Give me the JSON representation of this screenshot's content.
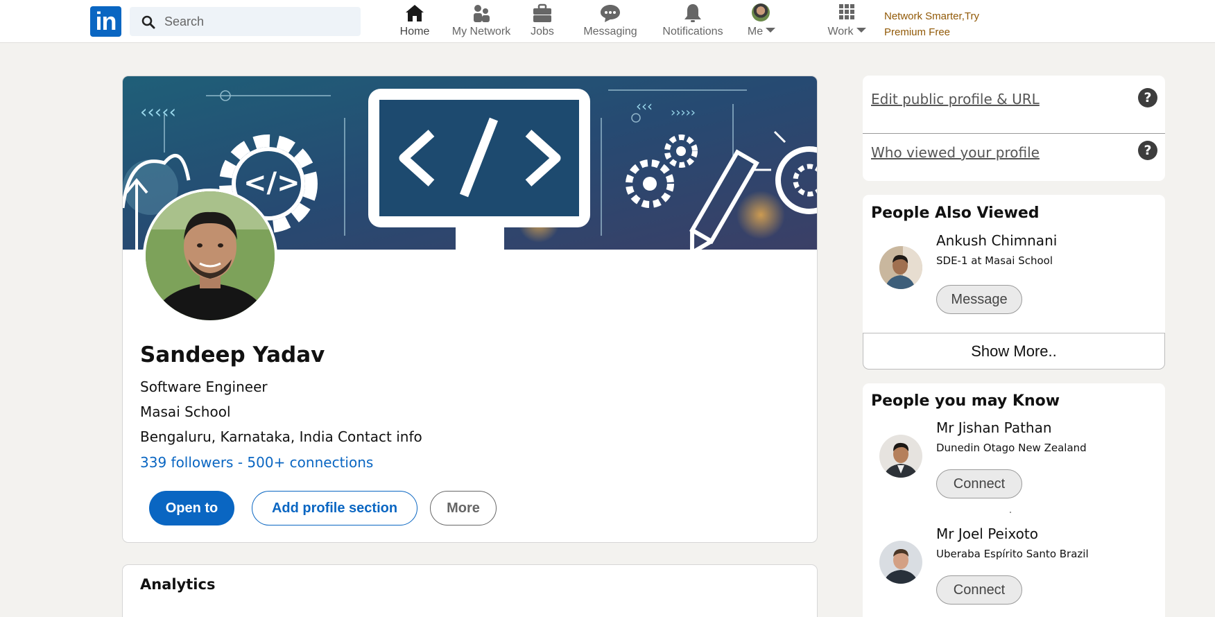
{
  "nav": {
    "search_placeholder": "Search",
    "items": [
      {
        "label": "Home",
        "icon": "home-icon"
      },
      {
        "label": "My Network",
        "icon": "network-icon"
      },
      {
        "label": "Jobs",
        "icon": "briefcase-icon"
      },
      {
        "label": "Messaging",
        "icon": "chat-icon"
      },
      {
        "label": "Notifications",
        "icon": "bell-icon"
      },
      {
        "label": "Me",
        "icon": "avatar"
      },
      {
        "label": "Work",
        "icon": "grid-icon"
      }
    ],
    "premium_line1": "Network Smarter,Try",
    "premium_line2": "Premium Free",
    "logo_text": "in"
  },
  "profile": {
    "name": "Sandeep Yadav",
    "headline": "Software Engineer",
    "company": "Masai School",
    "location": "Bengaluru, Karnataka, India Contact info",
    "stats": "339 followers - 500+ connections",
    "buttons": {
      "open_to": "Open to",
      "add_section": "Add profile section",
      "more": "More"
    }
  },
  "analytics": {
    "title": "Analytics"
  },
  "sidebar": {
    "links": [
      {
        "label": "Edit public profile & URL",
        "help": "?"
      },
      {
        "label": "Who viewed your profile",
        "help": "?"
      }
    ],
    "people_also_viewed": {
      "title": "People Also Viewed",
      "people": [
        {
          "name": "Ankush Chimnani",
          "subtitle": "SDE-1 at Masai School",
          "action": "Message"
        }
      ],
      "show_more": "Show More.."
    },
    "people_you_may_know": {
      "title": "People you may Know",
      "people": [
        {
          "name": "Mr Jishan Pathan",
          "subtitle": "Dunedin Otago New Zealand",
          "action": "Connect"
        },
        {
          "name": "Mr Joel Peixoto",
          "subtitle": "Uberaba Espírito Santo Brazil",
          "action": "Connect"
        }
      ]
    }
  },
  "colors": {
    "brand": "#0a66c2",
    "premium": "#915907",
    "background": "#f3f2ef"
  }
}
